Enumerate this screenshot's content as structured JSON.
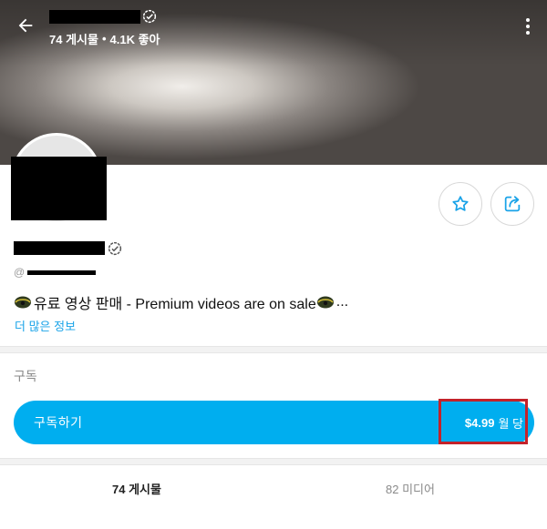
{
  "header": {
    "posts_count": "74 게시물",
    "separator": "•",
    "likes_count": "4.1K 좋아"
  },
  "profile": {
    "bio": "유료 영상 판매 - Premium videos are on sale",
    "bio_ellipsis": "...",
    "more_info": "더 많은 정보"
  },
  "subscription": {
    "section_title": "구독",
    "button_label": "구독하기",
    "price": "$4.99",
    "price_period": "월 당"
  },
  "tabs": [
    {
      "label": "74 게시물"
    },
    {
      "label": "82 미디어"
    }
  ],
  "icons": {
    "back": "arrow-left-icon",
    "verified": "verified-badge-icon",
    "more": "vertical-dots-icon",
    "star": "star-icon",
    "share": "share-icon",
    "emoji": "emoji-icon"
  },
  "colors": {
    "accent": "#00aeef",
    "link": "#1aa3e8",
    "highlight": "#c4222a"
  }
}
